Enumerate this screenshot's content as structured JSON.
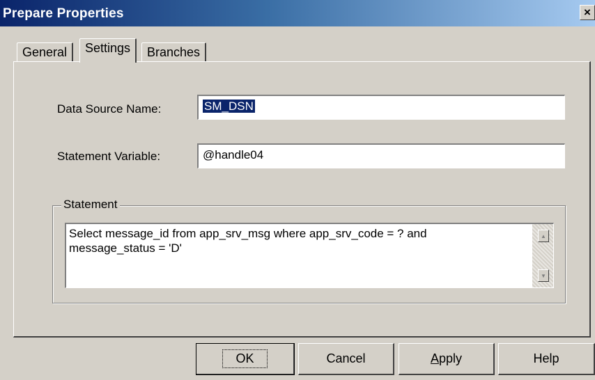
{
  "window": {
    "title": "Prepare Properties",
    "close_glyph": "×",
    "close_icon": "close-icon"
  },
  "tabs": [
    {
      "label": "General",
      "active": false
    },
    {
      "label": "Settings",
      "active": true
    },
    {
      "label": "Branches",
      "active": false
    }
  ],
  "form": {
    "dsn_label": "Data Source Name:",
    "dsn_value": "SM_DSN",
    "stmt_var_label": "Statement Variable:",
    "stmt_var_value": "@handle04",
    "statement_group_label": "Statement",
    "statement_text": "Select message_id from app_srv_msg where app_srv_code = ? and message_status = 'D'"
  },
  "scrollbar": {
    "up_glyph": "▲",
    "down_glyph": "▼",
    "up_icon": "scroll-up-arrow-icon",
    "down_icon": "scroll-down-arrow-icon"
  },
  "buttons": {
    "ok": "OK",
    "cancel": "Cancel",
    "apply": "Apply",
    "help": "Help"
  },
  "colors": {
    "titlebar_start": "#0a246a",
    "titlebar_end": "#a6caf0",
    "face": "#d4d0c8",
    "selection": "#0a246a"
  }
}
